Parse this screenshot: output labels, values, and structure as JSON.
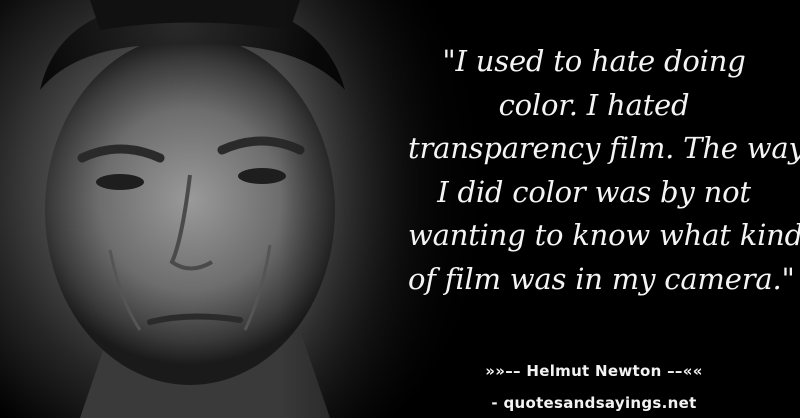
{
  "quote": {
    "lines": [
      "\"I used to hate doing",
      "color. I hated",
      "transparency film. The way",
      "I did color was by not",
      "wanting to know what kind",
      "of film was in my camera.\""
    ]
  },
  "attribution": {
    "text": "»»–– Helmut Newton ––««"
  },
  "source": {
    "text": "- quotesandsayings.net"
  }
}
